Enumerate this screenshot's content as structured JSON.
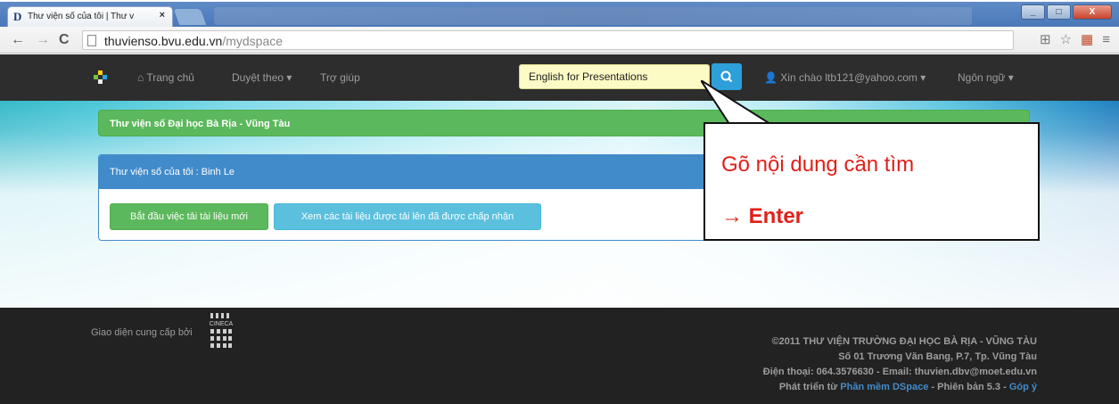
{
  "browser": {
    "tab_title": "Thư viện số của tôi | Thư v",
    "tab_close": "×",
    "favicon_letter": "D",
    "url_host": "thuvienso.bvu.edu.vn",
    "url_path": "/mydspace",
    "window_buttons": [
      "_",
      "□",
      "X"
    ]
  },
  "navbar": {
    "home": "Trang chủ",
    "browse": "Duyệt theo",
    "help": "Trợ giúp",
    "search_value": "English for Presentations",
    "user": "Xin chào ltb121@yahoo.com",
    "language": "Ngôn ngữ"
  },
  "main": {
    "site_title": "Thư viện số Đại học Bà Rịa - Vũng Tàu",
    "mydspace_title": "Thư viện số của tôi : Binh Le",
    "start_submission": "Bắt đầu việc tải tài liệu mới",
    "view_accepted": "Xem các tài liệu được tải lên đã được chấp nhận"
  },
  "callout": {
    "line1": "Gõ nội dung cần tìm",
    "arrow": "→",
    "line2": "Enter"
  },
  "footer": {
    "provided_by": "Giao diện cung cấp bởi",
    "cineca": "CINECA",
    "copyright": "©2011 THƯ VIỆN TRƯỜNG ĐẠI HỌC BÀ RỊA - VŨNG TÀU",
    "address": "Số 01 Trương Văn Bang, P.7, Tp. Vũng Tàu",
    "contact": "Điện thoại: 064.3576630 - Email: thuvien.dbv@moet.edu.vn",
    "dev_prefix": "Phát triển từ",
    "dspace_link": "Phần mềm DSpace",
    "version": "- Phiên bản 5.3 -",
    "feedback": "Góp ý"
  },
  "colors": {
    "navbar": "#2d2d2d",
    "green": "#5cb85c",
    "blue": "#428bca",
    "info": "#5bc0de",
    "search_bg": "#fdfbc5",
    "callout_text": "#e0201a",
    "footer": "#222222"
  }
}
